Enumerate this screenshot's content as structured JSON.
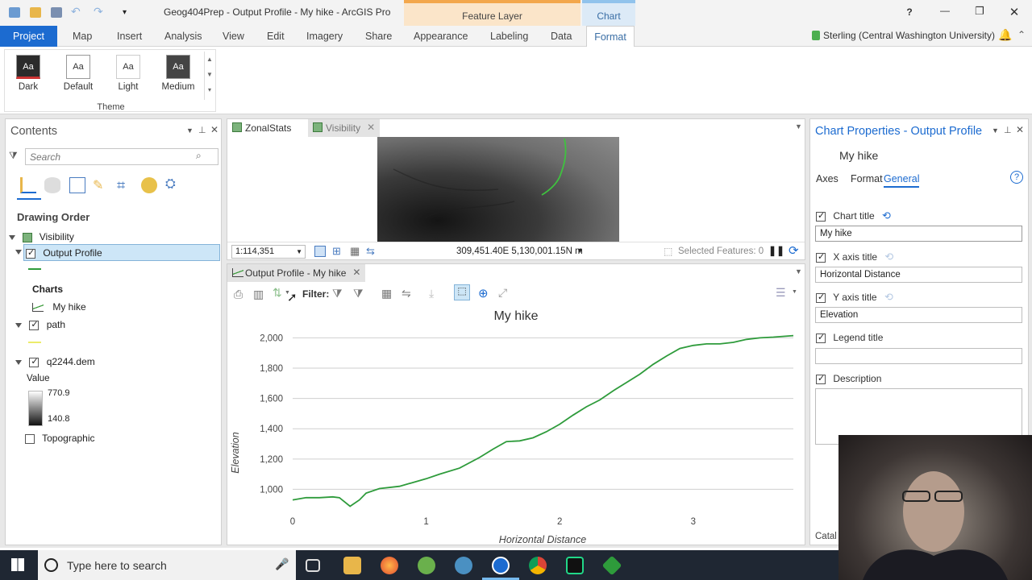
{
  "window": {
    "title": "Geog404Prep - Output Profile - My hike - ArcGIS Pro",
    "context_tabs": {
      "feature_layer": "Feature Layer",
      "chart": "Chart"
    },
    "help": "?",
    "minimize": "—",
    "restore": "❐",
    "close": "✕"
  },
  "ribbon": {
    "tabs": [
      "Project",
      "Map",
      "Insert",
      "Analysis",
      "View",
      "Edit",
      "Imagery",
      "Share",
      "Appearance",
      "Labeling",
      "Data",
      "Format"
    ],
    "user": "Sterling (Central Washington University)",
    "theme_group": {
      "label": "Theme",
      "swatch_text": "Aa",
      "items": [
        "Dark",
        "Default",
        "Light",
        "Medium"
      ]
    }
  },
  "contents": {
    "title": "Contents",
    "search_placeholder": "Search",
    "drawing_order": "Drawing Order",
    "layers": {
      "map": "Visibility",
      "output_profile": "Output Profile",
      "charts_heading": "Charts",
      "chart_item": "My hike",
      "path": "path",
      "dem": "q2244.dem",
      "value_label": "Value",
      "value_high": "770.9",
      "value_low": "140.8",
      "topographic": "Topographic"
    }
  },
  "mapview": {
    "tabs": [
      "ZonalStats",
      "Visibility"
    ],
    "scale": "1:114,351",
    "coordinates": "309,451.40E 5,130,001.15N m",
    "selected_features": "Selected Features: 0"
  },
  "chartview": {
    "tab": "Output Profile - My hike",
    "filter_label": "Filter:"
  },
  "chart_data": {
    "type": "line",
    "title": "My hike",
    "xlabel": "Horizontal Distance",
    "ylabel": "Elevation",
    "xlim": [
      0,
      3.75
    ],
    "ylim": [
      880,
      2050
    ],
    "xticks": [
      0,
      1,
      2,
      3
    ],
    "yticks": [
      1000,
      1200,
      1400,
      1600,
      1800,
      2000
    ],
    "ytick_labels": [
      "1,000",
      "1,200",
      "1,400",
      "1,600",
      "1,800",
      "2,000"
    ],
    "grid": true,
    "line_color": "#2e9b3b",
    "series": [
      {
        "x": [
          0,
          0.1,
          0.2,
          0.3,
          0.35,
          0.43,
          0.5,
          0.55,
          0.65,
          0.8,
          1.0,
          1.1,
          1.25,
          1.4,
          1.5,
          1.6,
          1.7,
          1.8,
          1.9,
          2.0,
          2.1,
          2.2,
          2.3,
          2.4,
          2.5,
          2.6,
          2.7,
          2.8,
          2.9,
          3.0,
          3.1,
          3.2,
          3.3,
          3.4,
          3.5,
          3.6,
          3.75
        ],
        "y": [
          930,
          945,
          945,
          950,
          945,
          888,
          930,
          975,
          1005,
          1020,
          1070,
          1100,
          1140,
          1210,
          1265,
          1315,
          1320,
          1340,
          1380,
          1430,
          1490,
          1545,
          1590,
          1650,
          1705,
          1760,
          1825,
          1880,
          1930,
          1950,
          1960,
          1960,
          1970,
          1990,
          2000,
          2005,
          2015
        ]
      }
    ]
  },
  "chart_properties": {
    "title": "Chart Properties - Output Profile",
    "subtitle": "My hike",
    "tabs": [
      "Axes",
      "Format",
      "General"
    ],
    "fields": {
      "chart_title_label": "Chart title",
      "chart_title_value": "My hike",
      "x_axis_label": "X axis title",
      "x_axis_value": "Horizontal Distance",
      "y_axis_label": "Y axis title",
      "y_axis_value": "Elevation",
      "legend_label": "Legend title",
      "legend_value": "",
      "description_label": "Description",
      "description_value": ""
    },
    "catalog_tab": "Catal"
  },
  "taskbar": {
    "search_placeholder": "Type here to search"
  }
}
